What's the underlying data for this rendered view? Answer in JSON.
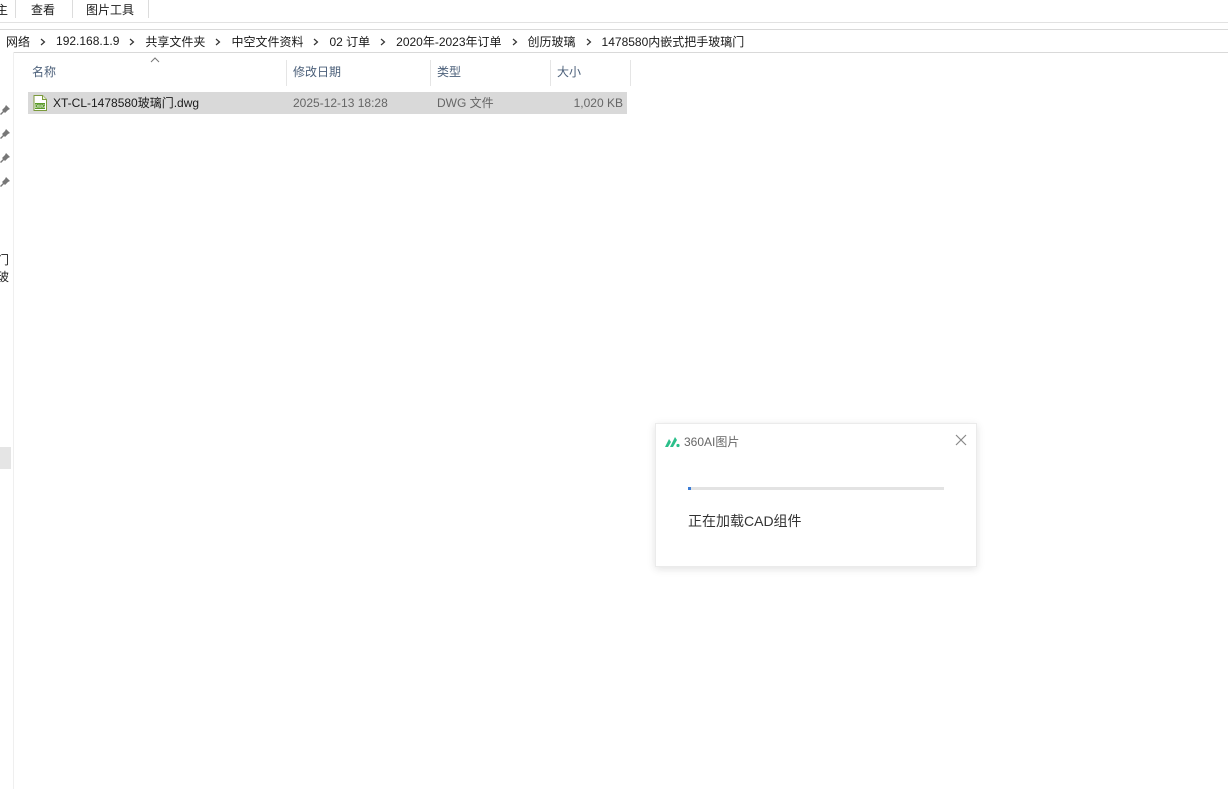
{
  "ribbon": {
    "tabs": [
      {
        "label": "主页"
      },
      {
        "label": "查看"
      },
      {
        "label": "图片工具"
      }
    ]
  },
  "breadcrumb": [
    "网络",
    "192.168.1.9",
    "共享文件夹",
    "中空文件资料",
    "02  订单",
    "2020年-2023年订单",
    "创历玻璃",
    "1478580内嵌式把手玻璃门"
  ],
  "nav": {
    "partial_label": "门玻"
  },
  "columns": {
    "name": "名称",
    "modified": "修改日期",
    "type": "类型",
    "size": "大小"
  },
  "files": [
    {
      "name": "XT-CL-1478580玻璃门.dwg",
      "modified": "2025-12-13 18:28",
      "type": "DWG 文件",
      "size": "1,020 KB",
      "icon": "dwg-file-icon",
      "selected": true
    }
  ],
  "popup": {
    "title": "360AI图片",
    "status": "正在加载CAD组件",
    "progress": 0.01,
    "accent": "#3a7bd5",
    "logo_color": "#2bbf8a"
  }
}
